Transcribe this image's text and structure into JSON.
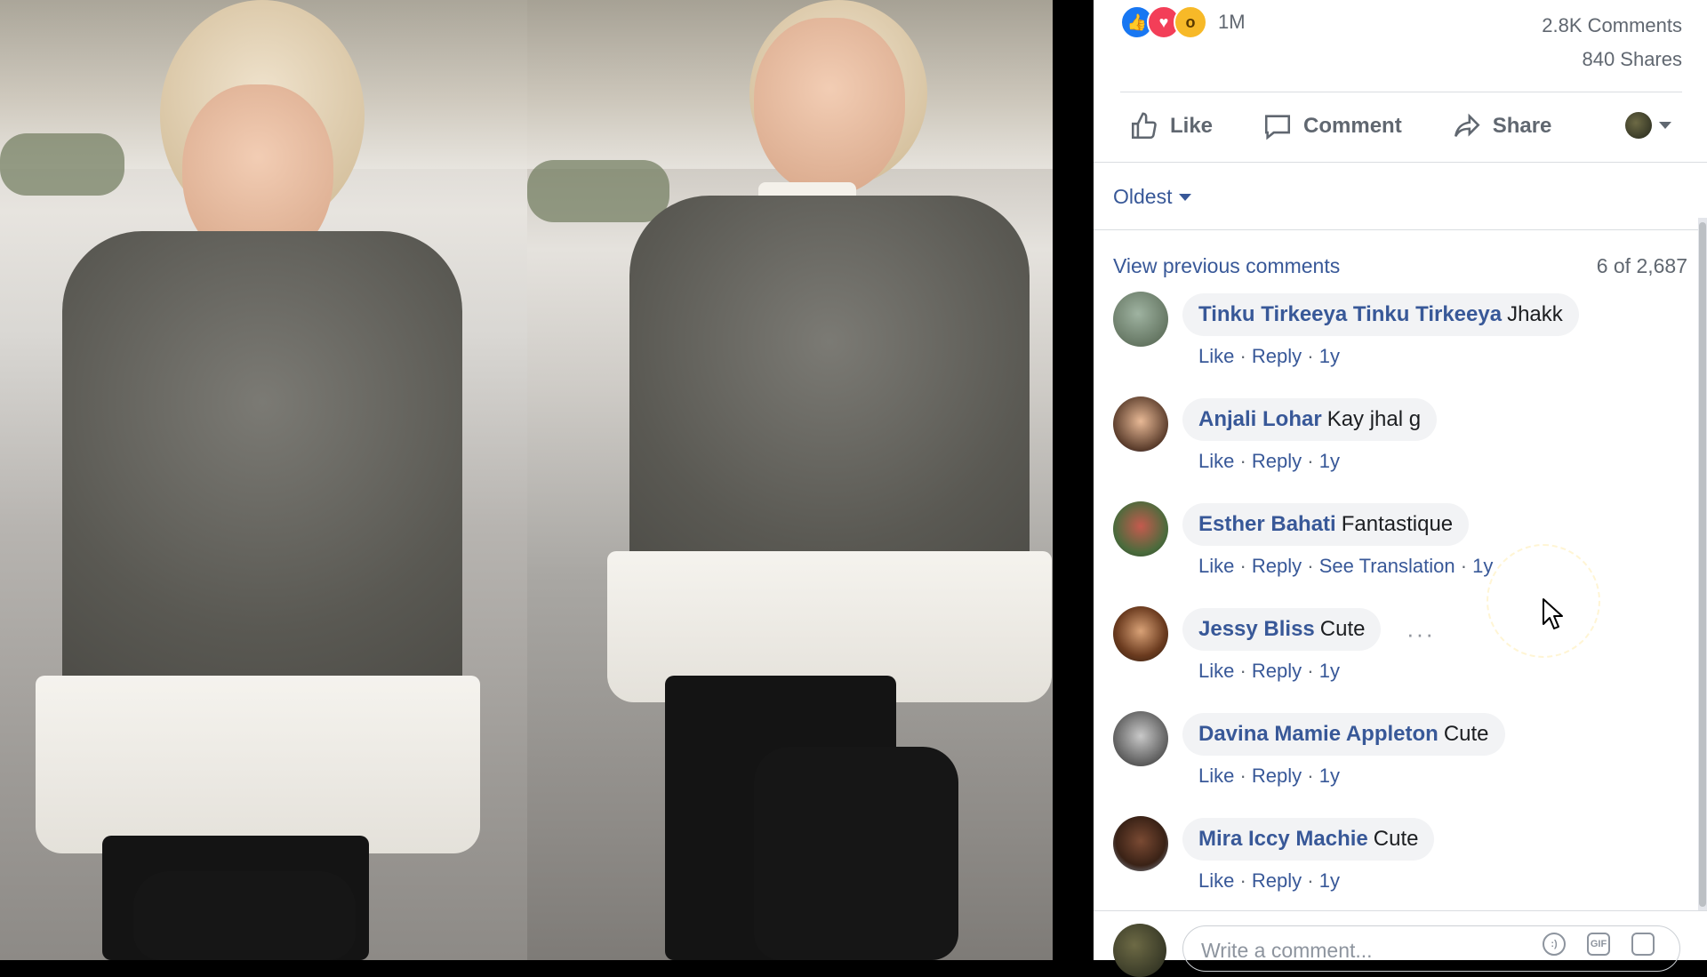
{
  "post_stats": {
    "reactions": [
      "like",
      "love",
      "wow"
    ],
    "reaction_count": "1M",
    "comments": "2.8K Comments",
    "shares": "840 Shares"
  },
  "actions": {
    "like": "Like",
    "comment": "Comment",
    "share": "Share"
  },
  "sort": {
    "label": "Oldest"
  },
  "comments_header": {
    "view_previous": "View previous comments",
    "count": "6 of 2,687"
  },
  "comments": [
    {
      "name": "Tinku Tirkeeya Tinku Tirkeeya",
      "text": "Jhakk",
      "like": "Like",
      "reply": "Reply",
      "time": "1y"
    },
    {
      "name": "Anjali Lohar",
      "text": "Kay jhal g",
      "like": "Like",
      "reply": "Reply",
      "time": "1y"
    },
    {
      "name": "Esther Bahati",
      "text": "Fantastique",
      "like": "Like",
      "reply": "Reply",
      "translate": "See Translation",
      "time": "1y"
    },
    {
      "name": "Jessy Bliss",
      "text": "Cute",
      "like": "Like",
      "reply": "Reply",
      "time": "1y",
      "more": "···"
    },
    {
      "name": "Davina Mamie Appleton",
      "text": "Cute",
      "like": "Like",
      "reply": "Reply",
      "time": "1y"
    },
    {
      "name": "Mira Iccy Machie",
      "text": "Cute",
      "like": "Like",
      "reply": "Reply",
      "time": "1y"
    }
  ],
  "composer": {
    "placeholder": "Write a comment...",
    "gif_label": "GIF"
  },
  "colors": {
    "link_blue": "#385898",
    "facebook_blue": "#1877f2",
    "bubble_bg": "#f2f3f5",
    "muted_text": "#606770"
  }
}
